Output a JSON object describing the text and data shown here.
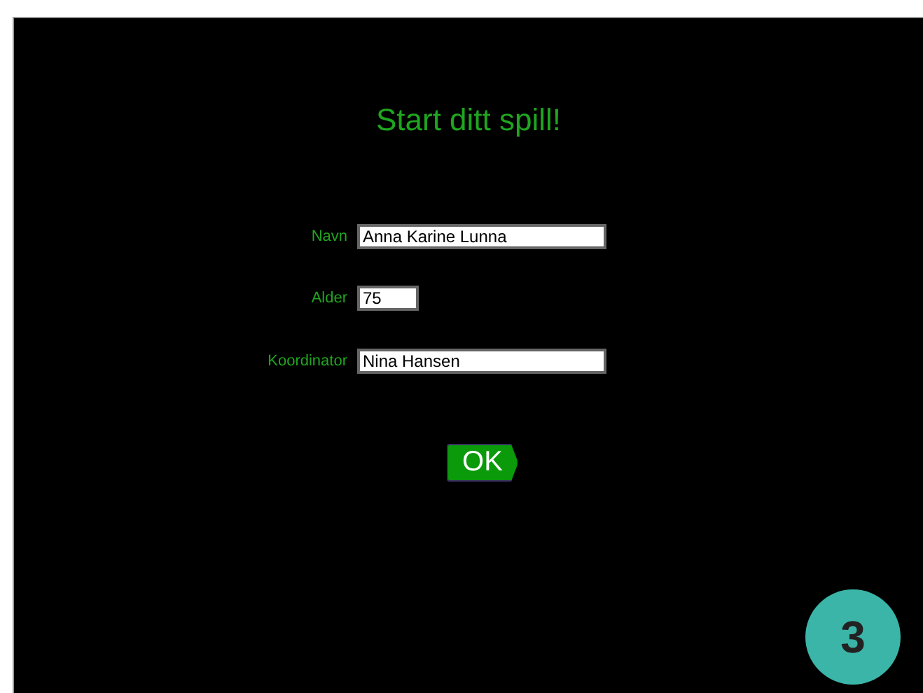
{
  "title": "Start ditt spill!",
  "fields": [
    {
      "label": "Navn",
      "value": "Anna Karine Lunna",
      "kind": "wide"
    },
    {
      "label": "Alder",
      "value": "75",
      "kind": "short"
    },
    {
      "label": "Koordinator",
      "value": "Nina Hansen",
      "kind": "wide"
    }
  ],
  "button": "OK",
  "badge": "3"
}
